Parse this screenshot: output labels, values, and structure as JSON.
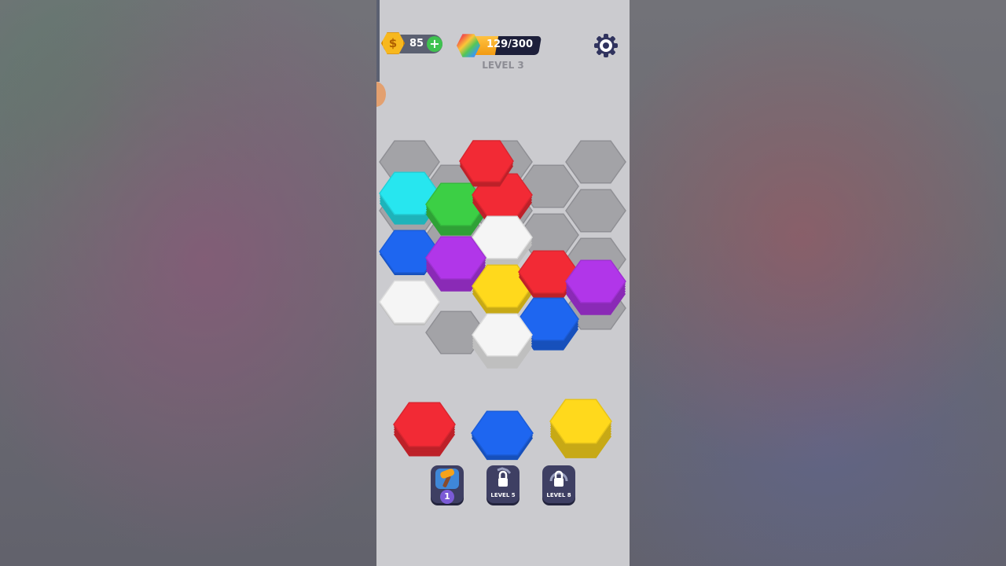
{
  "hud": {
    "coins": "85",
    "coin_symbol": "$",
    "add_symbol": "+",
    "progress_text": "129/300",
    "progress_fraction": 0.43,
    "level_label": "LEVEL 3"
  },
  "board": {
    "empty_color": "#a3a3a7",
    "stacks": [
      {
        "cell": "cyan",
        "color": "#27e6ef",
        "layers": 5
      },
      {
        "cell": "green",
        "color": "#3ccf45",
        "layers": 5
      },
      {
        "cell": "red-top",
        "color": "#f22a35",
        "layers": 4
      },
      {
        "cell": "white-mid",
        "color": "#f5f5f5",
        "layers": 4
      },
      {
        "cell": "blue-left",
        "color": "#1e66f0",
        "layers": 2
      },
      {
        "cell": "purple-left",
        "color": "#b136e9",
        "layers": 6
      },
      {
        "cell": "yellow",
        "color": "#ffd91c",
        "layers": 4
      },
      {
        "cell": "red-right",
        "color": "#f22a35",
        "layers": 3
      },
      {
        "cell": "purple-right",
        "color": "#b136e9",
        "layers": 6
      },
      {
        "cell": "white-left",
        "color": "#f5f5f5",
        "layers": 2
      },
      {
        "cell": "blue-bottom",
        "color": "#1e66f0",
        "layers": 5
      },
      {
        "cell": "white-bottom",
        "color": "#f5f5f5",
        "layers": 6
      }
    ]
  },
  "tray": [
    {
      "color": "#f22a35",
      "layers": 5
    },
    {
      "color": "#1e66f0",
      "layers": 3
    },
    {
      "color": "#ffd91c",
      "layers": 7
    }
  ],
  "boosters": [
    {
      "name": "hammer",
      "badge": "1",
      "locked": false
    },
    {
      "name": "swap",
      "label": "LEVEL 5",
      "locked": true
    },
    {
      "name": "shuffle",
      "label": "LEVEL 8",
      "locked": true
    }
  ]
}
